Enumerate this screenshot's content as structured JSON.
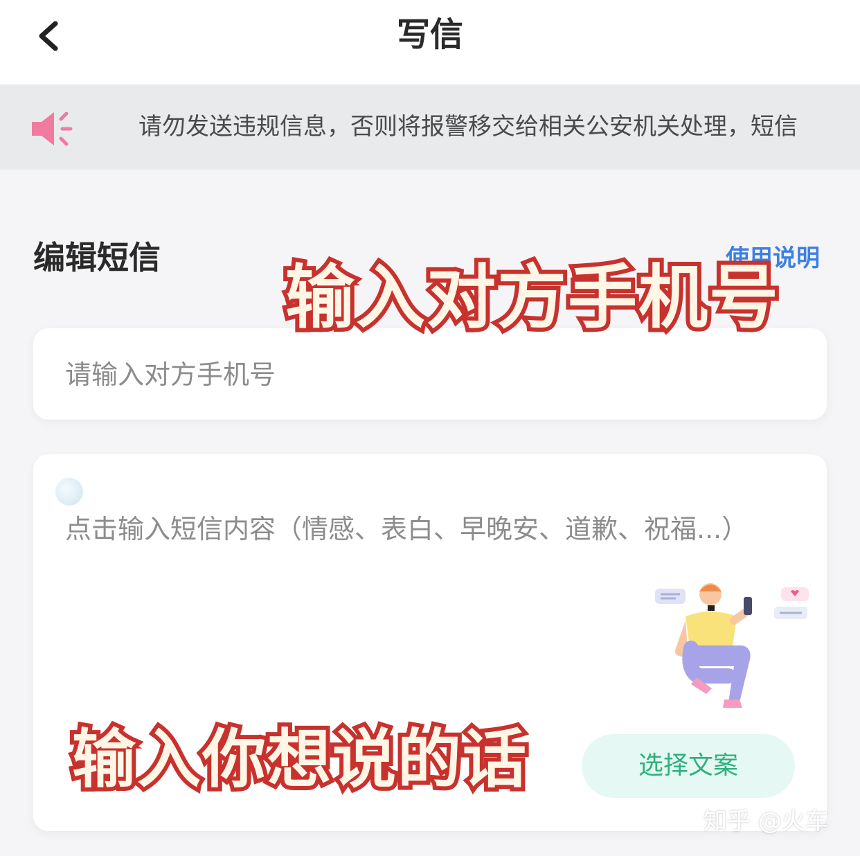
{
  "header": {
    "title": "写信",
    "back_icon": "chevron-left-icon"
  },
  "notice": {
    "icon": "speaker-icon",
    "text": "请勿发送违规信息，否则将报警移交给相关公安机关处理，短信"
  },
  "editor": {
    "section_title": "编辑短信",
    "help_link": "使用说明",
    "phone_placeholder": "请输入对方手机号",
    "content_placeholder": "点击输入短信内容（情感、表白、早晚安、道歉、祝福...）",
    "choose_button": "选择文案"
  },
  "captions": {
    "phone": "输入对方手机号",
    "content": "输入你想说的话"
  },
  "watermark": "知乎 @火车",
  "colors": {
    "speaker_icon": "#f07aa0",
    "help_link": "#3d7fe0",
    "choose_button_text": "#2cb17f",
    "choose_button_bg": "#e6f8f3",
    "caption_stroke": "#c8322e",
    "caption_fill": "#fff6e6"
  }
}
